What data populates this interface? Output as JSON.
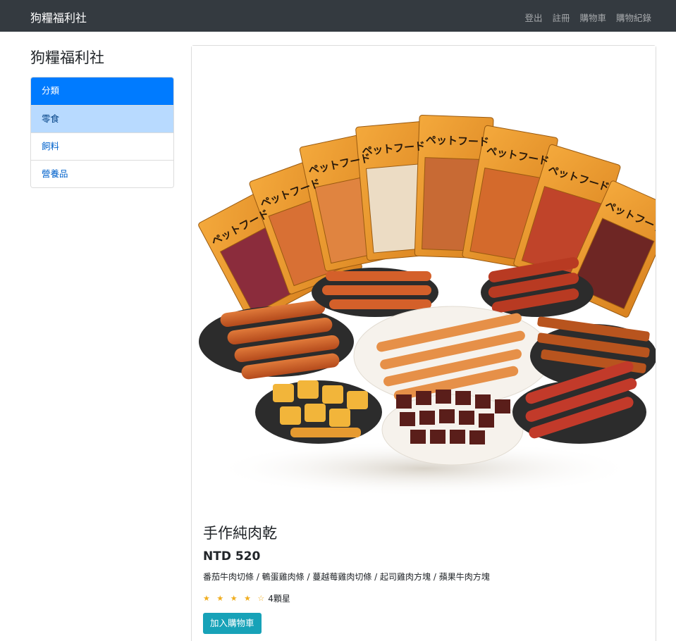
{
  "navbar": {
    "brand": "狗糧福利社",
    "links": [
      "登出",
      "註冊",
      "購物車",
      "購物紀錄"
    ]
  },
  "sidebar": {
    "title": "狗糧福利社",
    "items": [
      {
        "label": "分類"
      },
      {
        "label": "零食"
      },
      {
        "label": "飼料"
      },
      {
        "label": "營養品"
      }
    ]
  },
  "product": {
    "title": "手作純肉乾",
    "price": "NTD 520",
    "description": "番茄牛肉切條 / 鵪蛋雞肉條 / 蔓越莓雞肉切條 / 起司雞肉方塊 / 蘋果牛肉方塊",
    "stars": "★ ★ ★ ★ ☆",
    "rating_text": "4顆星",
    "add_to_cart": "加入購物車",
    "package_text": "ペットフード"
  },
  "colors": {
    "navbar": "#343a40",
    "primary": "#007bff",
    "selected": "#b8daff",
    "info": "#17a2b8",
    "star": "#f0ad1e"
  }
}
